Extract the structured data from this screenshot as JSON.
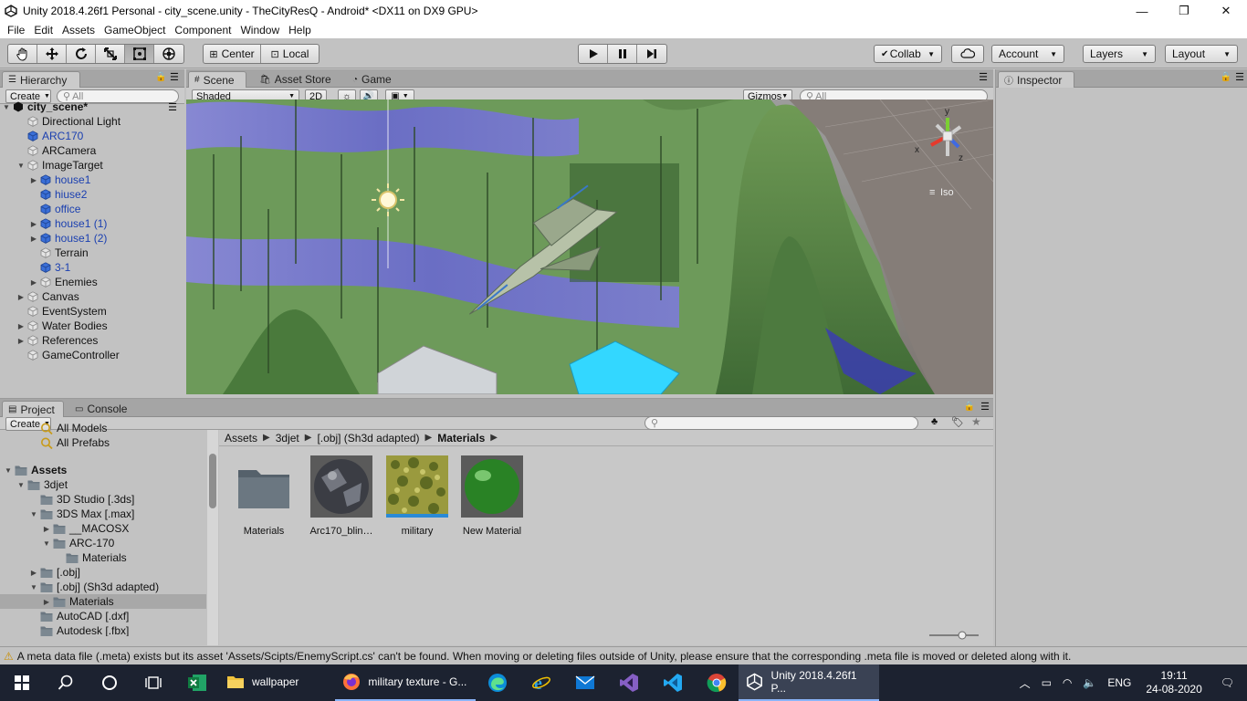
{
  "window": {
    "title": "Unity 2018.4.26f1 Personal - city_scene.unity - TheCityResQ - Android* <DX11 on DX9 GPU>",
    "minimize": "—",
    "restore": "❐",
    "close": "✕"
  },
  "menu": [
    "File",
    "Edit",
    "Assets",
    "GameObject",
    "Component",
    "Window",
    "Help"
  ],
  "toolbar": {
    "pivot_center": "Center",
    "pivot_local": "Local",
    "collab": "Collab",
    "account": "Account",
    "layers": "Layers",
    "layout": "Layout"
  },
  "hierarchy": {
    "tab": "Hierarchy",
    "create": "Create",
    "search_placeholder": "All",
    "scene_name": "city_scene*",
    "items": [
      {
        "label": "Directional Light",
        "depth": 1,
        "arrow": "",
        "prefab": false
      },
      {
        "label": "ARC170",
        "depth": 1,
        "arrow": "",
        "prefab": true
      },
      {
        "label": "ARCamera",
        "depth": 1,
        "arrow": "",
        "prefab": false
      },
      {
        "label": "ImageTarget",
        "depth": 1,
        "arrow": "▼",
        "prefab": false
      },
      {
        "label": "house1",
        "depth": 2,
        "arrow": "▶",
        "prefab": true
      },
      {
        "label": "hiuse2",
        "depth": 2,
        "arrow": "",
        "prefab": true
      },
      {
        "label": "office",
        "depth": 2,
        "arrow": "",
        "prefab": true
      },
      {
        "label": "house1 (1)",
        "depth": 2,
        "arrow": "▶",
        "prefab": true
      },
      {
        "label": "house1 (2)",
        "depth": 2,
        "arrow": "▶",
        "prefab": true
      },
      {
        "label": "Terrain",
        "depth": 2,
        "arrow": "",
        "prefab": false
      },
      {
        "label": "3-1",
        "depth": 2,
        "arrow": "",
        "prefab": true
      },
      {
        "label": "Enemies",
        "depth": 2,
        "arrow": "▶",
        "prefab": false
      },
      {
        "label": "Canvas",
        "depth": 1,
        "arrow": "▶",
        "prefab": false
      },
      {
        "label": "EventSystem",
        "depth": 1,
        "arrow": "",
        "prefab": false
      },
      {
        "label": "Water Bodies",
        "depth": 1,
        "arrow": "▶",
        "prefab": false
      },
      {
        "label": "References",
        "depth": 1,
        "arrow": "▶",
        "prefab": false
      },
      {
        "label": "GameController",
        "depth": 1,
        "arrow": "",
        "prefab": false
      }
    ]
  },
  "scene": {
    "tabs": [
      "Scene",
      "Asset Store",
      "Game"
    ],
    "shading": "Shaded",
    "mode_2d": "2D",
    "gizmos": "Gizmos",
    "search_placeholder": "All",
    "gizmo_x": "x",
    "gizmo_y": "y",
    "gizmo_z": "z",
    "projection": "Iso"
  },
  "inspector": {
    "tab": "Inspector"
  },
  "project": {
    "tabs": [
      "Project",
      "Console"
    ],
    "create": "Create",
    "tree": [
      {
        "label": "All Models",
        "depth": 2,
        "arrow": "",
        "kind": "search"
      },
      {
        "label": "All Prefabs",
        "depth": 2,
        "arrow": "",
        "kind": "search"
      },
      {
        "label": "",
        "depth": 0,
        "arrow": "",
        "kind": "spacer"
      },
      {
        "label": "Assets",
        "depth": 0,
        "arrow": "▼",
        "kind": "folder",
        "bold": true
      },
      {
        "label": "3djet",
        "depth": 1,
        "arrow": "▼",
        "kind": "folder"
      },
      {
        "label": "3D Studio [.3ds]",
        "depth": 2,
        "arrow": "",
        "kind": "folder"
      },
      {
        "label": "3DS Max [.max]",
        "depth": 2,
        "arrow": "▼",
        "kind": "folder"
      },
      {
        "label": "__MACOSX",
        "depth": 3,
        "arrow": "▶",
        "kind": "folder"
      },
      {
        "label": "ARC-170",
        "depth": 3,
        "arrow": "▼",
        "kind": "folder"
      },
      {
        "label": "Materials",
        "depth": 4,
        "arrow": "",
        "kind": "folder"
      },
      {
        "label": "[.obj]",
        "depth": 2,
        "arrow": "▶",
        "kind": "folder"
      },
      {
        "label": "[.obj] (Sh3d adapted)",
        "depth": 2,
        "arrow": "▼",
        "kind": "folder"
      },
      {
        "label": "Materials",
        "depth": 3,
        "arrow": "▶",
        "kind": "folder",
        "selected": true
      },
      {
        "label": "AutoCAD [.dxf]",
        "depth": 2,
        "arrow": "",
        "kind": "folder"
      },
      {
        "label": "Autodesk [.fbx]",
        "depth": 2,
        "arrow": "",
        "kind": "folder"
      }
    ],
    "breadcrumb": [
      "Assets",
      "3djet",
      "[.obj] (Sh3d adapted)",
      "Materials"
    ],
    "assets": [
      {
        "label": "Materials",
        "type": "folder"
      },
      {
        "label": "Arc170_blin…",
        "type": "sphere-dark"
      },
      {
        "label": "military",
        "type": "texture"
      },
      {
        "label": "New Material",
        "type": "sphere-green"
      }
    ]
  },
  "status": {
    "message": "A meta data file (.meta) exists but its asset 'Assets/Scipts/EnemyScript.cs' can't be found. When moving or deleting files outside of Unity, please ensure that the corresponding .meta file is moved or deleted along with it."
  },
  "taskbar": {
    "apps": [
      {
        "label": "wallpaper",
        "icon": "folder-icon"
      },
      {
        "label": "military texture - G...",
        "icon": "firefox-icon"
      },
      {
        "label": "Unity 2018.4.26f1 P...",
        "icon": "unity-icon"
      }
    ],
    "language": "ENG",
    "time": "19:11",
    "date": "24-08-2020"
  },
  "colors": {
    "unity_bg": "#c2c2c2",
    "prefab_blue": "#1a3fb0",
    "taskbar": "#1c2230",
    "selected_row": "#a8a8a8"
  }
}
